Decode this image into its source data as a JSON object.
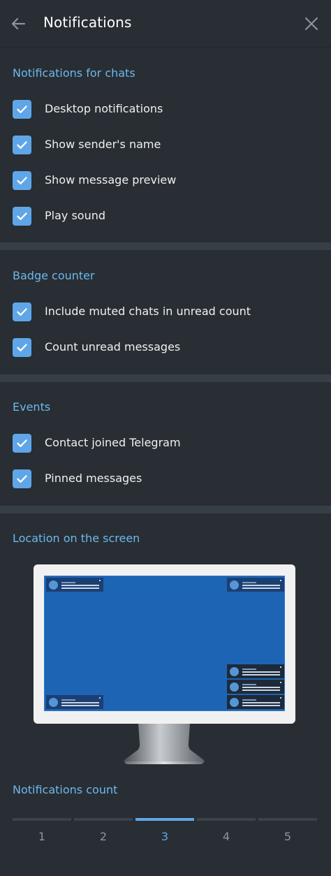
{
  "header": {
    "title": "Notifications"
  },
  "sections": {
    "chats": {
      "title": "Notifications for chats",
      "items": [
        {
          "label": "Desktop notifications",
          "checked": true
        },
        {
          "label": "Show sender's name",
          "checked": true
        },
        {
          "label": "Show message preview",
          "checked": true
        },
        {
          "label": "Play sound",
          "checked": true
        }
      ]
    },
    "badge": {
      "title": "Badge counter",
      "items": [
        {
          "label": "Include muted chats in unread count",
          "checked": true
        },
        {
          "label": "Count unread messages",
          "checked": true
        }
      ]
    },
    "events": {
      "title": "Events",
      "items": [
        {
          "label": "Contact joined Telegram",
          "checked": true
        },
        {
          "label": "Pinned messages",
          "checked": true
        }
      ]
    },
    "location": {
      "title": "Location on the screen",
      "selected_corner": "bottom-right"
    },
    "count": {
      "title": "Notifications count",
      "options": [
        "1",
        "2",
        "3",
        "4",
        "5"
      ],
      "selected": "3"
    }
  },
  "colors": {
    "background": "#282e33",
    "accent": "#6cb8ef",
    "checkbox": "#5fa6e8",
    "divider": "#363f46",
    "screen": "#1e64b4"
  }
}
